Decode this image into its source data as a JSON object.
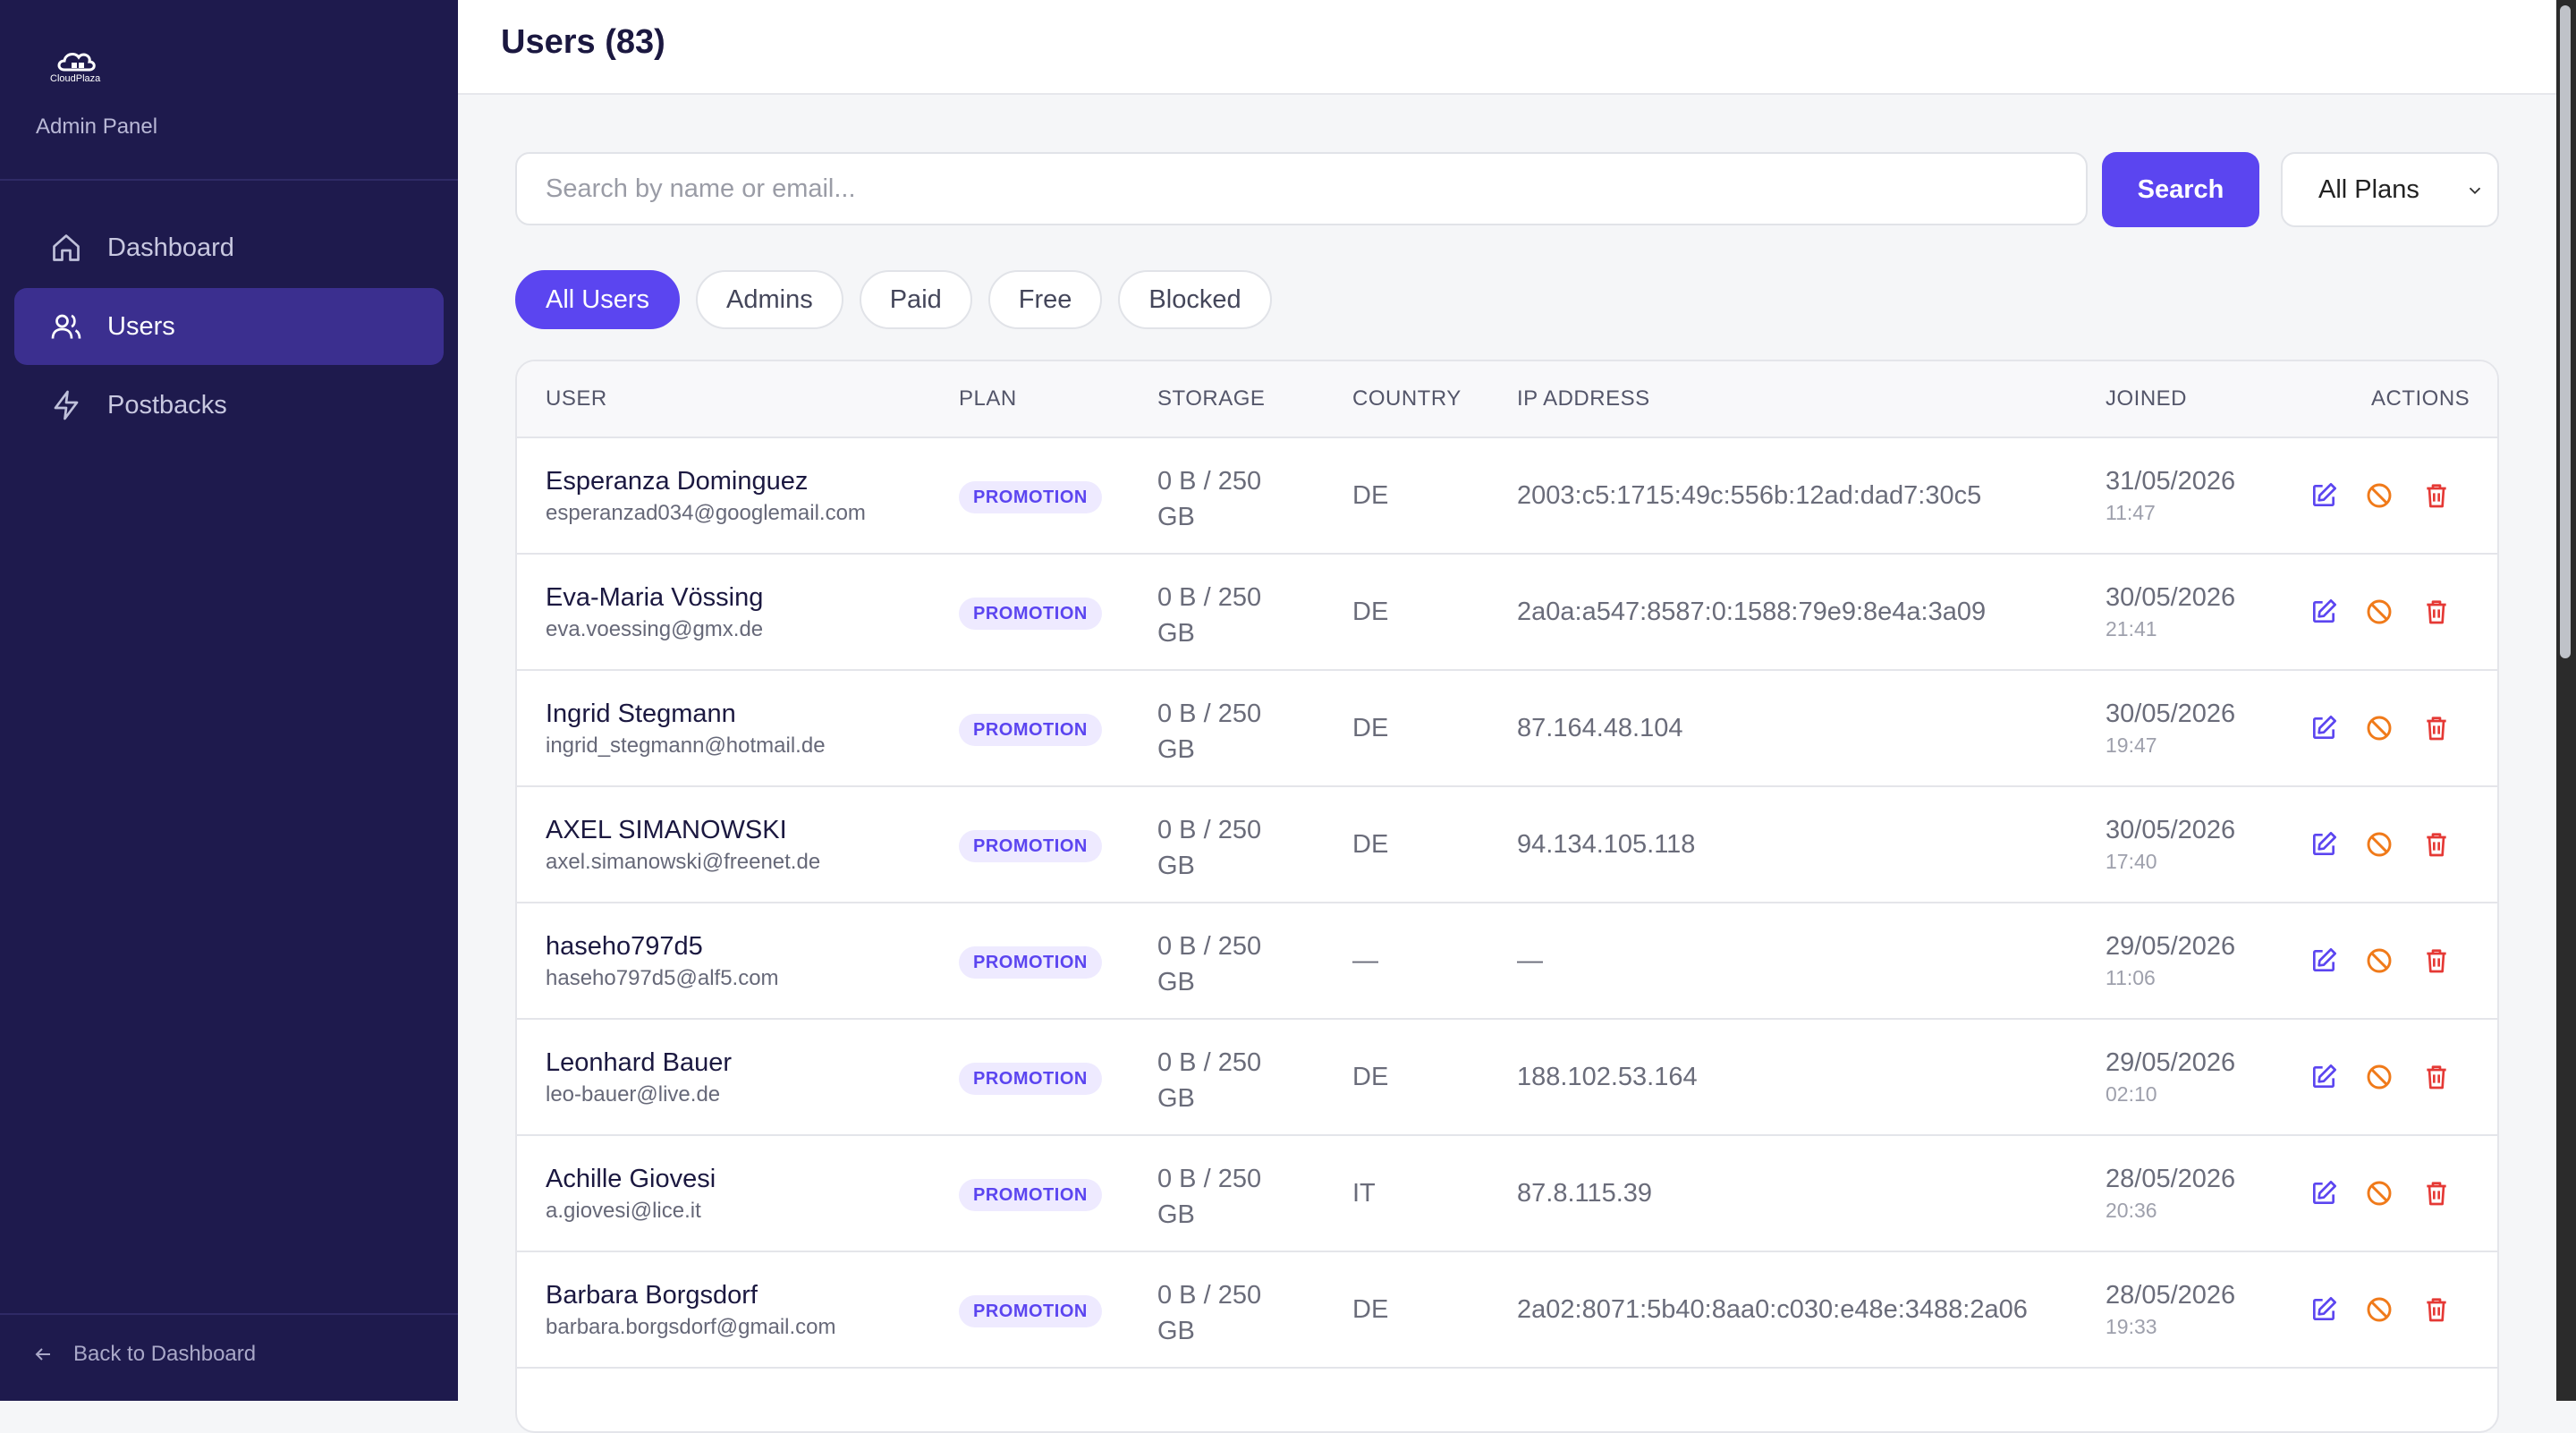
{
  "brand": {
    "logo_text": "CloudPlaza",
    "panel_label": "Admin Panel"
  },
  "nav": {
    "items": [
      {
        "label": "Dashboard",
        "icon": "home-icon",
        "active": false
      },
      {
        "label": "Users",
        "icon": "users-icon",
        "active": true
      },
      {
        "label": "Postbacks",
        "icon": "lightning-icon",
        "active": false
      }
    ],
    "back_label": "Back to Dashboard"
  },
  "header": {
    "title": "Users (83)"
  },
  "search": {
    "placeholder": "Search by name or email...",
    "value": "",
    "button_label": "Search"
  },
  "plan_filter": {
    "selected": "All Plans"
  },
  "tabs": [
    {
      "label": "All Users",
      "active": true
    },
    {
      "label": "Admins",
      "active": false
    },
    {
      "label": "Paid",
      "active": false
    },
    {
      "label": "Free",
      "active": false
    },
    {
      "label": "Blocked",
      "active": false
    }
  ],
  "table": {
    "columns": [
      "USER",
      "PLAN",
      "STORAGE",
      "COUNTRY",
      "IP ADDRESS",
      "JOINED",
      "ACTIONS"
    ],
    "rows": [
      {
        "name": "Esperanza Dominguez",
        "email": "esperanzad034@googlemail.com",
        "plan": "PROMOTION",
        "storage": "0 B / 250 GB",
        "country": "DE",
        "ip": "2003:c5:1715:49c:556b:12ad:dad7:30c5",
        "joined_date": "31/05/2026",
        "joined_time": "11:47"
      },
      {
        "name": "Eva-Maria Vössing",
        "email": "eva.voessing@gmx.de",
        "plan": "PROMOTION",
        "storage": "0 B / 250 GB",
        "country": "DE",
        "ip": "2a0a:a547:8587:0:1588:79e9:8e4a:3a09",
        "joined_date": "30/05/2026",
        "joined_time": "21:41"
      },
      {
        "name": "Ingrid Stegmann",
        "email": "ingrid_stegmann@hotmail.de",
        "plan": "PROMOTION",
        "storage": "0 B / 250 GB",
        "country": "DE",
        "ip": "87.164.48.104",
        "joined_date": "30/05/2026",
        "joined_time": "19:47"
      },
      {
        "name": "AXEL SIMANOWSKI",
        "email": "axel.simanowski@freenet.de",
        "plan": "PROMOTION",
        "storage": "0 B / 250 GB",
        "country": "DE",
        "ip": "94.134.105.118",
        "joined_date": "30/05/2026",
        "joined_time": "17:40"
      },
      {
        "name": "haseho797d5",
        "email": "haseho797d5@alf5.com",
        "plan": "PROMOTION",
        "storage": "0 B / 250 GB",
        "country": "—",
        "ip": "—",
        "joined_date": "29/05/2026",
        "joined_time": "11:06"
      },
      {
        "name": "Leonhard Bauer",
        "email": "leo-bauer@live.de",
        "plan": "PROMOTION",
        "storage": "0 B / 250 GB",
        "country": "DE",
        "ip": "188.102.53.164",
        "joined_date": "29/05/2026",
        "joined_time": "02:10"
      },
      {
        "name": "Achille Giovesi",
        "email": "a.giovesi@lice.it",
        "plan": "PROMOTION",
        "storage": "0 B / 250 GB",
        "country": "IT",
        "ip": "87.8.115.39",
        "joined_date": "28/05/2026",
        "joined_time": "20:36"
      },
      {
        "name": "Barbara Borgsdorf",
        "email": "barbara.borgsdorf@gmail.com",
        "plan": "PROMOTION",
        "storage": "0 B / 250 GB",
        "country": "DE",
        "ip": "2a02:8071:5b40:8aa0:c030:e48e:3488:2a06",
        "joined_date": "28/05/2026",
        "joined_time": "19:33"
      }
    ],
    "action_icons": [
      "edit-icon",
      "block-icon",
      "trash-icon"
    ]
  },
  "colors": {
    "sidebar_bg": "#1e1a4d",
    "accent": "#5b45f0",
    "block": "#f07a1a",
    "delete": "#e53935"
  }
}
